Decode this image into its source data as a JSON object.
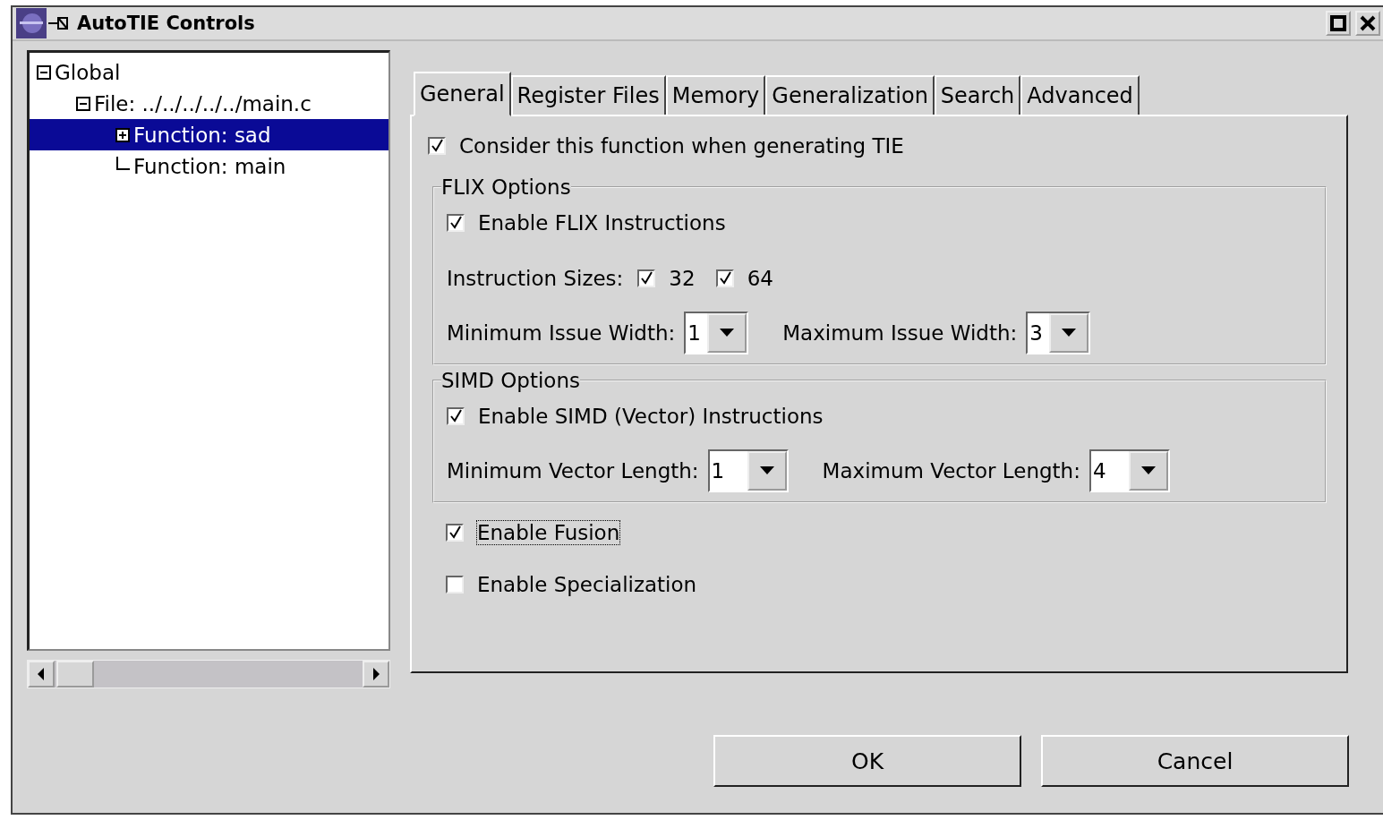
{
  "window": {
    "title": "AutoTIE Controls"
  },
  "tree": [
    {
      "label": "Global",
      "expanded": true,
      "selected": false,
      "children": [
        {
          "label": "File: ../../../../../main.c",
          "expanded": true,
          "selected": false,
          "children": [
            {
              "label": "Function: sad",
              "expanded": false,
              "selected": true
            },
            {
              "label": "Function: main",
              "selected": false
            }
          ]
        }
      ]
    }
  ],
  "tabs": [
    {
      "label": "General",
      "selected": true
    },
    {
      "label": "Register Files",
      "selected": false
    },
    {
      "label": "Memory",
      "selected": false
    },
    {
      "label": "Generalization",
      "selected": false
    },
    {
      "label": "Search",
      "selected": false
    },
    {
      "label": "Advanced",
      "selected": false
    }
  ],
  "consider": {
    "label": "Consider this function when generating TIE",
    "checked": true
  },
  "flix": {
    "title": "FLIX Options",
    "enable": {
      "label": "Enable FLIX Instructions",
      "checked": true
    },
    "sizes_label": "Instruction Sizes:",
    "sizes": [
      {
        "label": "32",
        "checked": true
      },
      {
        "label": "64",
        "checked": true
      }
    ],
    "dropdowns": [
      {
        "label": "Minimum Issue Width:",
        "value": "1"
      },
      {
        "label": "Maximum Issue Width:",
        "value": "3"
      }
    ]
  },
  "simd": {
    "title": "SIMD Options",
    "enable": {
      "label": "Enable SIMD (Vector) Instructions",
      "checked": true
    },
    "dropdowns": [
      {
        "label": "Minimum Vector Length:",
        "value": "1"
      },
      {
        "label": "Maximum Vector Length:",
        "value": "4"
      }
    ]
  },
  "options": [
    {
      "label": "Enable Fusion",
      "checked": true,
      "focused": true
    },
    {
      "label": "Enable Specialization",
      "checked": false,
      "focused": false
    }
  ],
  "buttons": [
    {
      "label": "OK"
    },
    {
      "label": "Cancel"
    }
  ]
}
